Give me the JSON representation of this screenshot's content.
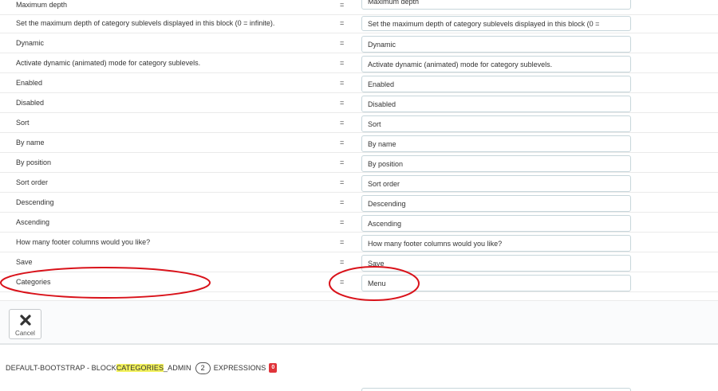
{
  "rows": [
    {
      "source": "Maximum depth",
      "eq": "=",
      "value": "Maximum depth"
    },
    {
      "source": "Set the maximum depth of category sublevels displayed in this block (0 = infinite).",
      "eq": "=",
      "value": "Set the maximum depth of category sublevels displayed in this block (0 ="
    },
    {
      "source": "Dynamic",
      "eq": "=",
      "value": "Dynamic"
    },
    {
      "source": "Activate dynamic (animated) mode for category sublevels.",
      "eq": "=",
      "value": "Activate dynamic (animated) mode for category sublevels."
    },
    {
      "source": "Enabled",
      "eq": "=",
      "value": "Enabled"
    },
    {
      "source": "Disabled",
      "eq": "=",
      "value": "Disabled"
    },
    {
      "source": "Sort",
      "eq": "=",
      "value": "Sort"
    },
    {
      "source": "By name",
      "eq": "=",
      "value": "By name"
    },
    {
      "source": "By position",
      "eq": "=",
      "value": "By position"
    },
    {
      "source": "Sort order",
      "eq": "=",
      "value": "Sort order"
    },
    {
      "source": "Descending",
      "eq": "=",
      "value": "Descending"
    },
    {
      "source": "Ascending",
      "eq": "=",
      "value": "Ascending"
    },
    {
      "source": "How many footer columns would you like?",
      "eq": "=",
      "value": "How many footer columns would you like?"
    },
    {
      "source": "Save",
      "eq": "=",
      "value": "Save"
    },
    {
      "source": "Categories",
      "eq": "=",
      "value": "Menu"
    }
  ],
  "toolbar": {
    "cancel_label": "Cancel",
    "cancel_icon": "close-icon"
  },
  "section": {
    "prefix": "DEFAULT-BOOTSTRAP - BLOCK",
    "highlight": "CATEGORIES",
    "suffix": "_ADMIN",
    "count": "2",
    "expressions_label": "EXPRESSIONS",
    "missing_count": "0"
  },
  "colors": {
    "annotation": "#d9121a",
    "highlight": "#f2f15c",
    "badge_red": "#e0343a"
  }
}
